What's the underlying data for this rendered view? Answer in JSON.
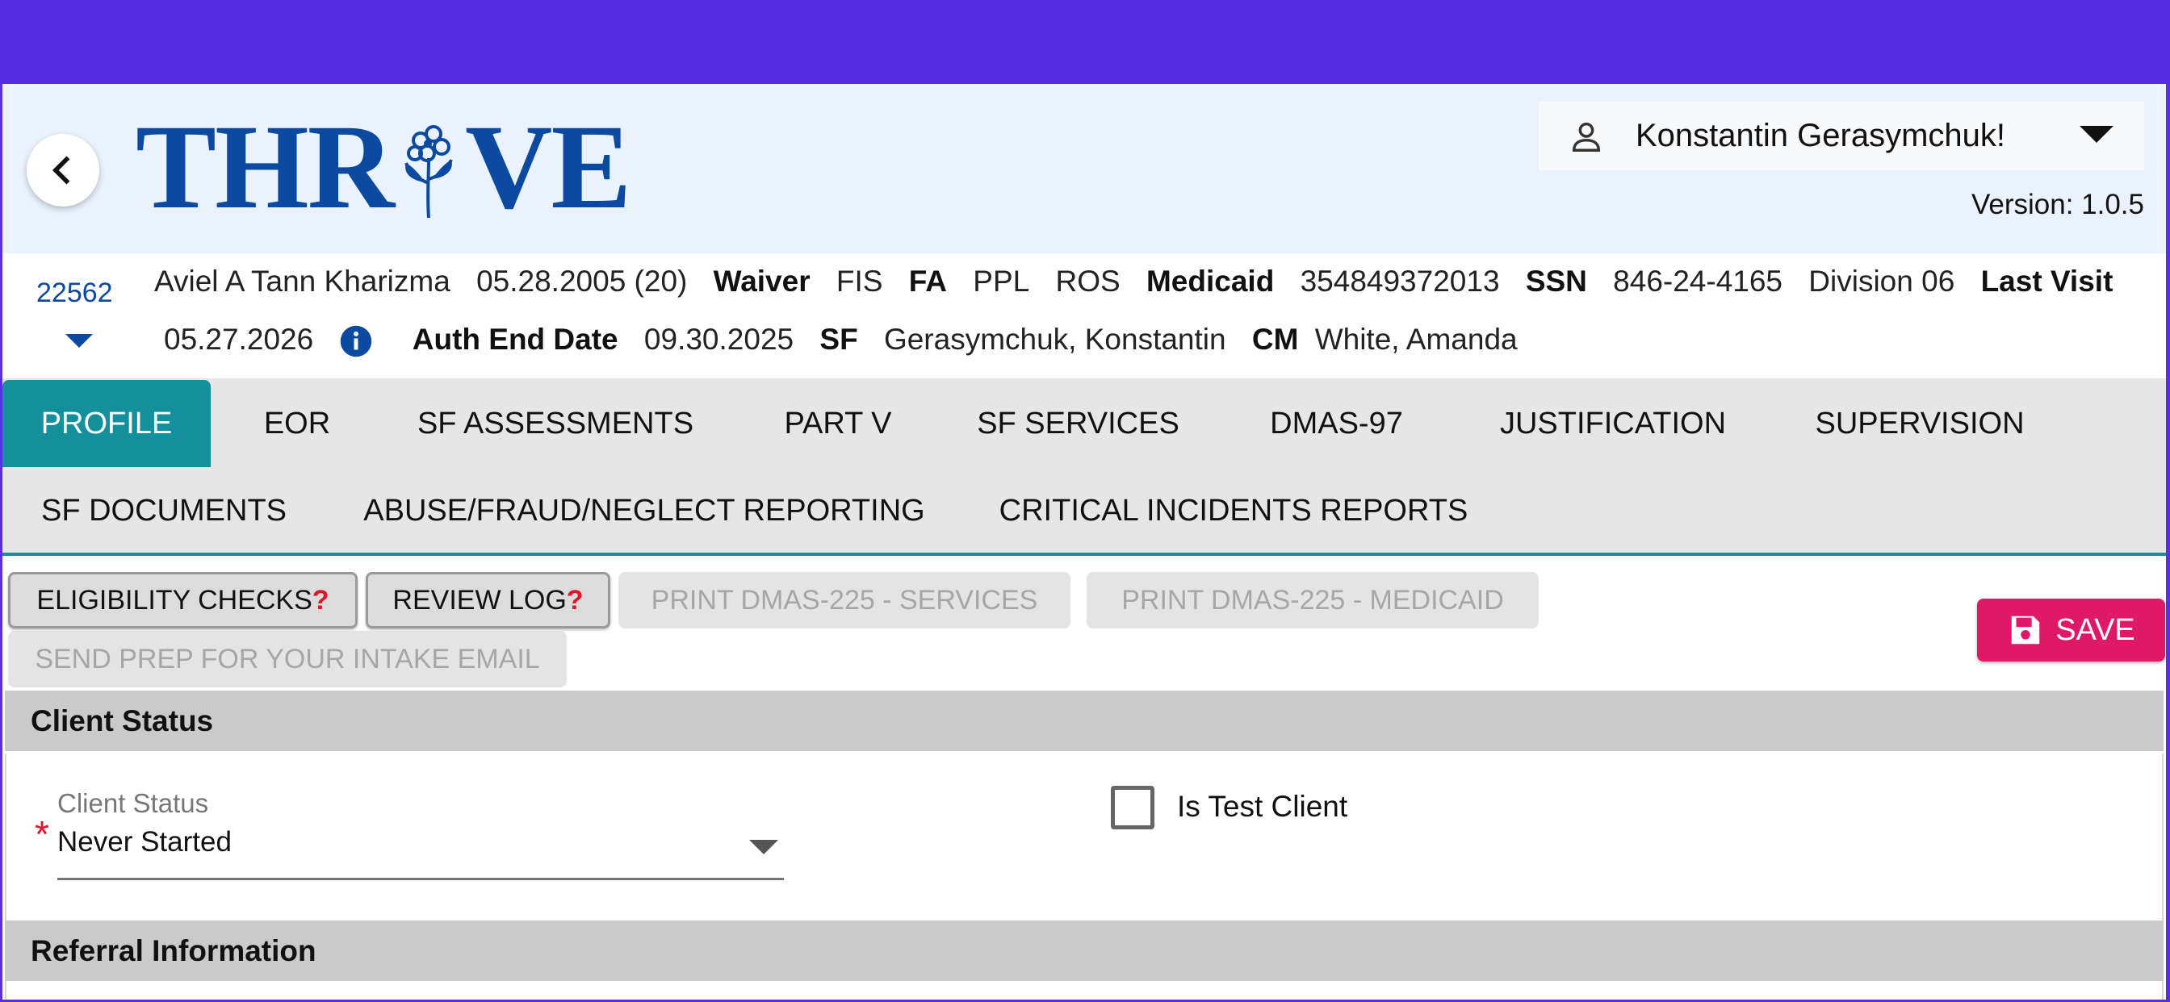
{
  "header": {
    "logo_text_left": "THR",
    "logo_text_right": "VE",
    "user_name": "Konstantin Gerasymchuk!",
    "version": "Version: 1.0.5"
  },
  "client": {
    "id": "22562",
    "name": "Aviel A Tann Kharizma",
    "dob": "05.28.2005 (20)",
    "waiver_label": "Waiver",
    "waiver_value": "FIS",
    "fa_label": "FA",
    "fa_value": "PPL",
    "ros": "ROS",
    "medicaid_label": "Medicaid",
    "medicaid_value": "354849372013",
    "ssn_label": "SSN",
    "ssn_value": "846-24-4165",
    "division": "Division 06",
    "last_visit_label": "Last Visit",
    "last_visit_value": "05.27.2026",
    "auth_end_label": "Auth End Date",
    "auth_end_value": "09.30.2025",
    "sf_label": "SF",
    "sf_value": "Gerasymchuk, Konstantin",
    "cm_label": "CM",
    "cm_value": "White, Amanda"
  },
  "tabs": {
    "profile": "PROFILE",
    "eor": "EOR",
    "sf_assessments": "SF ASSESSMENTS",
    "part_v": "PART V",
    "sf_services": "SF SERVICES",
    "dmas97": "DMAS-97",
    "justification": "JUSTIFICATION",
    "supervision": "SUPERVISION",
    "sf_documents": "SF DOCUMENTS",
    "abuse": "ABUSE/FRAUD/NEGLECT REPORTING",
    "critical": "CRITICAL INCIDENTS REPORTS"
  },
  "actions": {
    "eligibility": "ELIGIBILITY CHECKS",
    "review_log": "REVIEW LOG",
    "qmark": "?",
    "print_services": "PRINT DMAS-225 - SERVICES",
    "print_medicaid": "PRINT DMAS-225 - MEDICAID",
    "send_prep": "SEND PREP FOR YOUR INTAKE EMAIL",
    "save": "SAVE"
  },
  "client_status_section": {
    "title": "Client Status",
    "field_label": "Client Status",
    "required_mark": "*",
    "field_value": "Never Started",
    "checkbox_label": "Is Test Client"
  },
  "referral_section": {
    "title": "Referral Information"
  },
  "colors": {
    "brand_blue": "#0b4aa0",
    "active_tab": "#14909d",
    "save_button": "#e01868",
    "status_bar": "#552de3"
  }
}
